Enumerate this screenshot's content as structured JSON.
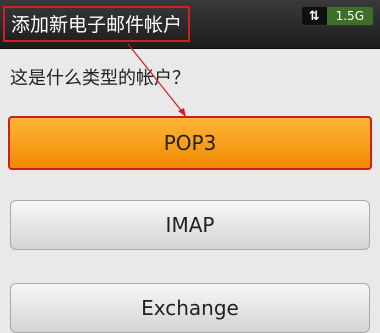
{
  "header": {
    "title": "添加新电子邮件帐户",
    "status": {
      "transfer_icon": "⇅",
      "data_usage": "1.5G"
    }
  },
  "prompt": "这是什么类型的帐户？",
  "account_types": [
    {
      "label": "POP3",
      "selected": true
    },
    {
      "label": "IMAP",
      "selected": false
    },
    {
      "label": "Exchange",
      "selected": false
    }
  ],
  "colors": {
    "selected_bg": "#f59b12",
    "highlight_border": "#cc1f1f",
    "titlebar_bg": "#222222"
  }
}
